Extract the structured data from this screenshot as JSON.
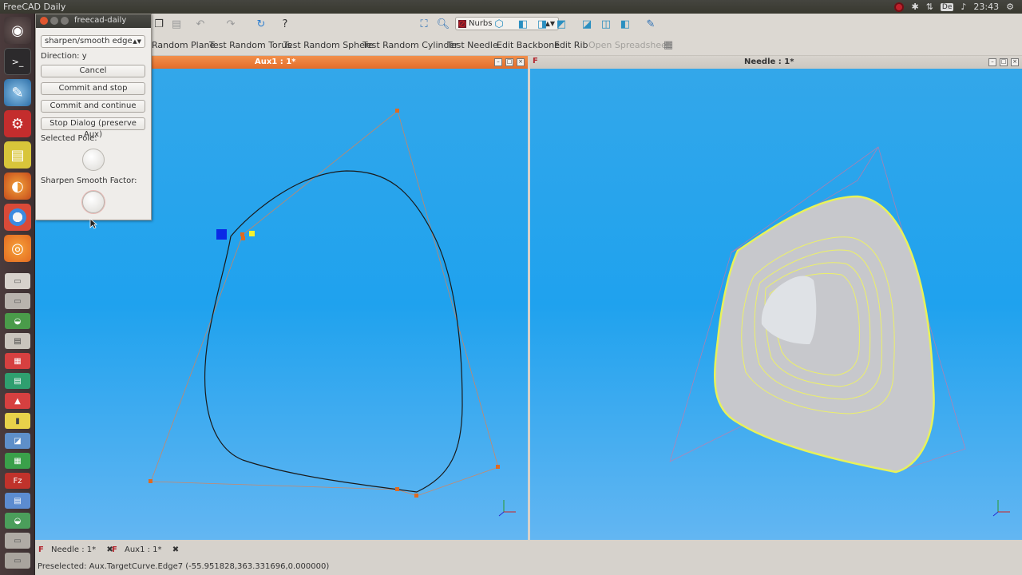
{
  "os": {
    "window_title": "FreeCAD Daily",
    "clock": "23:43",
    "keyboard_layout": "De"
  },
  "dialog": {
    "title": "freecad-daily",
    "mode_select": "sharpen/smooth edge",
    "direction": "Direction: y",
    "cancel": "Cancel",
    "commit_stop": "Commit and stop",
    "commit_continue": "Commit and continue",
    "stop_dialog": "Stop Dialog (preserve Aux)",
    "selected_pole_label": "Selected  Pole:",
    "sharpen_factor_label": "Sharpen Smooth Factor:"
  },
  "toolbar": {
    "workbench_select": "Nurbs",
    "commands": [
      "Random Plane",
      "Test Random Torus",
      "Test Random Sphere",
      "Test Random Cylinder",
      "Test Needle",
      "Edit Backbone",
      "Edit Rib",
      "Open Spreadsheet"
    ]
  },
  "views": {
    "left_title": "Aux1 : 1*",
    "right_title": "Needle : 1*"
  },
  "tabs": [
    {
      "label": "Needle : 1*"
    },
    {
      "label": "Aux1 : 1*"
    }
  ],
  "status": "Preselected: Aux.TargetCurve.Edge7 (-55.951828,363.331696,0.000000)",
  "colors": {
    "curve": "#1a1a1a",
    "control_polygon": "#e08050",
    "surface_edge": "#e8f25a",
    "active_title": "#ee7e3a"
  }
}
